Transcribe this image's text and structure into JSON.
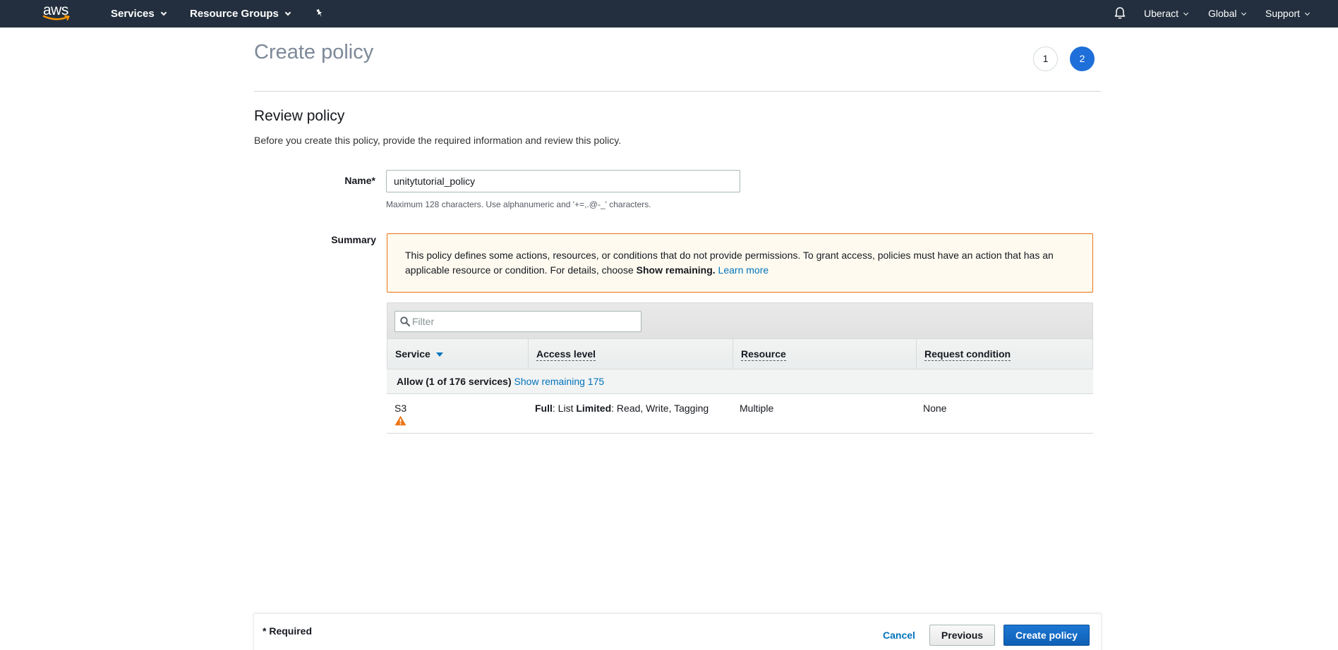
{
  "nav": {
    "logo_text": "aws",
    "services": "Services",
    "resource_groups": "Resource Groups",
    "account": "Uberact",
    "region": "Global",
    "support": "Support"
  },
  "page": {
    "title": "Create policy",
    "steps": [
      "1",
      "2"
    ],
    "active_step": "2"
  },
  "review": {
    "title": "Review policy",
    "description": "Before you create this policy, provide the required information and review this policy.",
    "name_label": "Name*",
    "name_value": "unitytutorial_policy",
    "name_hint": "Maximum 128 characters. Use alphanumeric and '+=,.@-_' characters.",
    "summary_label": "Summary"
  },
  "alert": {
    "text": "This policy defines some actions, resources, or conditions that do not provide permissions. To grant access, policies must have an action that has an applicable resource or condition. For details, choose ",
    "bold": "Show remaining.",
    "link": "Learn more"
  },
  "table": {
    "filter_placeholder": "Filter",
    "columns": [
      "Service",
      "Access level",
      "Resource",
      "Request condition"
    ],
    "group_label": "Allow (1 of 176 services)",
    "group_link": "Show remaining 175",
    "row": {
      "service": "S3",
      "access_full": "Full",
      "access_full_rest": ": List ",
      "access_limited": "Limited",
      "access_limited_rest": ": Read, Write, Tagging",
      "resource": "Multiple",
      "condition": "None"
    }
  },
  "footer": {
    "required": "* Required",
    "cancel": "Cancel",
    "previous": "Previous",
    "create": "Create policy"
  },
  "colors": {
    "nav_bg": "#232f3e",
    "primary": "#1e6fd9",
    "link": "#0073bb",
    "warning": "#ec7211",
    "alert_bg": "#fffaf0"
  }
}
